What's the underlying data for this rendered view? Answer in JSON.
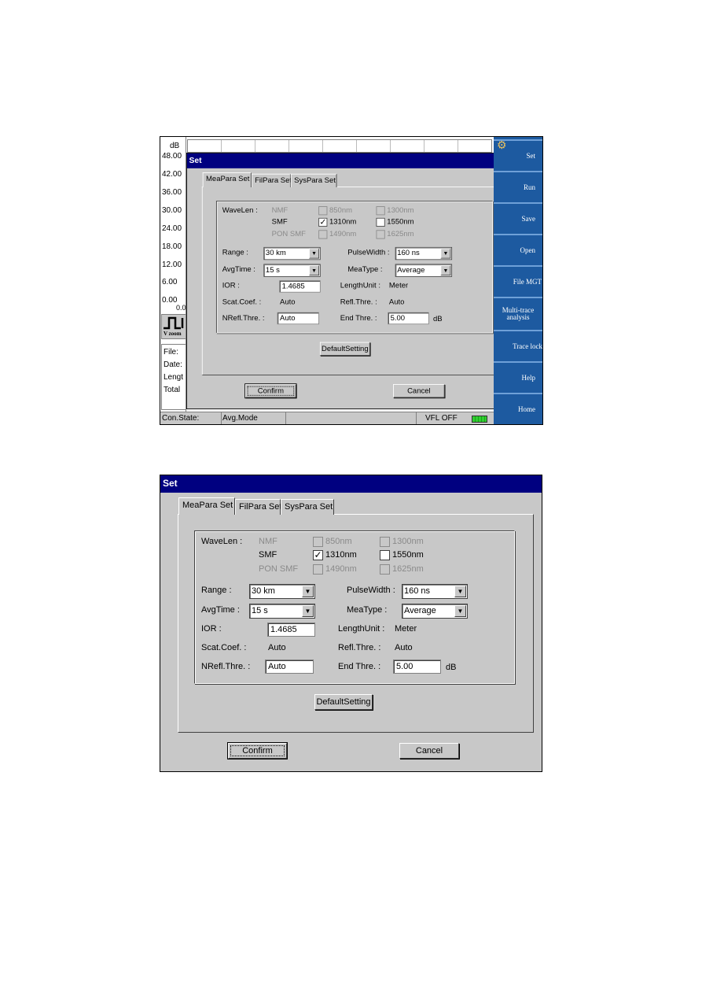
{
  "app": {
    "chart": {
      "unit": "dB",
      "ticks": [
        "48.00",
        "42.00",
        "36.00",
        "30.00",
        "24.00",
        "18.00",
        "12.00",
        "6.00",
        "0.00"
      ],
      "x_start": "0.0"
    },
    "vzoom_label": "V zoom",
    "info": [
      "File:",
      "Date:",
      "Lengt",
      "Total"
    ],
    "sidebar": [
      "Set",
      "Run",
      "Save",
      "Open",
      "File MGT",
      "Multi-trace analysis",
      "Trace lock",
      "Help",
      "Home"
    ],
    "status": {
      "con_state": "Con.State:",
      "avg_mode": "Avg.Mode",
      "vfl": "VFL OFF",
      "battery_icon": "battery-icon"
    },
    "colors": {
      "sidebar": "#1d5aa0",
      "title_bar": "#000080"
    }
  },
  "dialog": {
    "title": "Set",
    "tabs": [
      "MeaPara Set",
      "FilPara Set",
      "SysPara Set"
    ],
    "wavelen_label": "WaveLen :",
    "fibers": [
      "NMF",
      "SMF",
      "PON SMF"
    ],
    "wavelengths": [
      {
        "label": "850nm",
        "checked": false,
        "enabled": false
      },
      {
        "label": "1300nm",
        "checked": false,
        "enabled": false
      },
      {
        "label": "1310nm",
        "checked": true,
        "enabled": true
      },
      {
        "label": "1550nm",
        "checked": false,
        "enabled": true
      },
      {
        "label": "1490nm",
        "checked": false,
        "enabled": false
      },
      {
        "label": "1625nm",
        "checked": false,
        "enabled": false
      }
    ],
    "range": {
      "label": "Range :",
      "value": "30 km"
    },
    "pulse_width": {
      "label": "PulseWidth :",
      "value": "160 ns"
    },
    "avg_time": {
      "label": "AvgTime :",
      "value": "15 s"
    },
    "mea_type": {
      "label": "MeaType :",
      "value": "Average"
    },
    "ior": {
      "label": "IOR :",
      "value": "1.4685"
    },
    "length_unit": {
      "label": "LengthUnit :",
      "value": "Meter"
    },
    "scat_coef": {
      "label": "Scat.Coef. :",
      "value": "Auto"
    },
    "refl_thre": {
      "label": "Refl.Thre. :",
      "value": "Auto"
    },
    "nrefl_thre": {
      "label": "NRefl.Thre. :",
      "value": "Auto"
    },
    "end_thre": {
      "label": "End Thre. :",
      "value": "5.00",
      "unit": "dB"
    },
    "default_setting": "DefaultSetting",
    "confirm": "Confirm",
    "cancel": "Cancel"
  }
}
